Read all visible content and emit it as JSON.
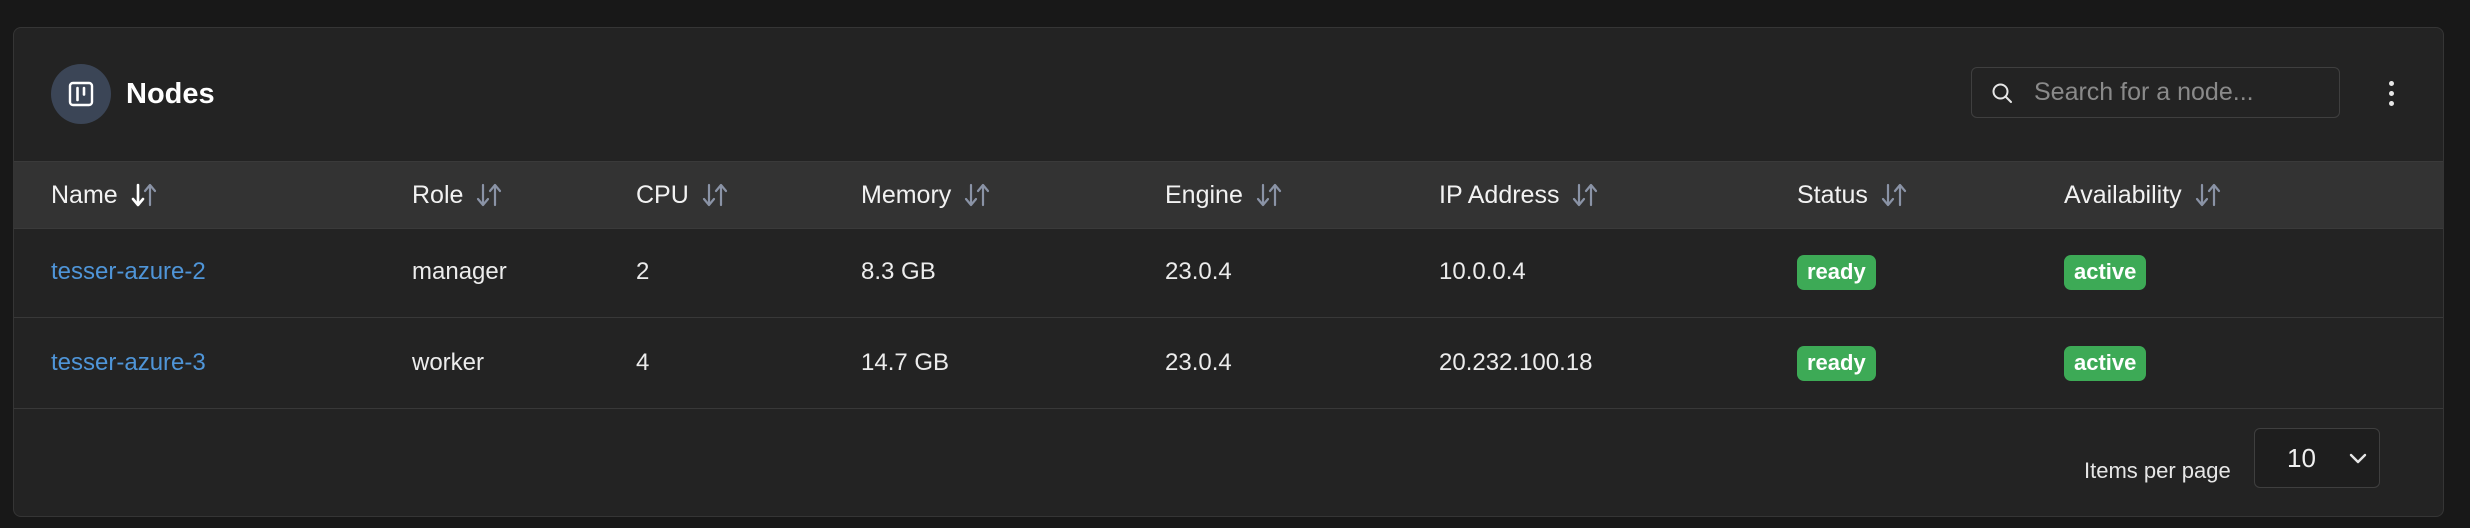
{
  "panel": {
    "title": "Nodes",
    "title_icon": "board-icon",
    "search": {
      "placeholder": "Search for a node...",
      "value": ""
    },
    "menu_icon": "kebab-menu-icon"
  },
  "table": {
    "columns": [
      {
        "key": "name",
        "label": "Name",
        "sorted": "desc"
      },
      {
        "key": "role",
        "label": "Role",
        "sorted": null
      },
      {
        "key": "cpu",
        "label": "CPU",
        "sorted": null
      },
      {
        "key": "memory",
        "label": "Memory",
        "sorted": null
      },
      {
        "key": "engine",
        "label": "Engine",
        "sorted": null
      },
      {
        "key": "ip",
        "label": "IP Address",
        "sorted": null
      },
      {
        "key": "status",
        "label": "Status",
        "sorted": null
      },
      {
        "key": "availability",
        "label": "Availability",
        "sorted": null
      }
    ],
    "rows": [
      {
        "name": "tesser-azure-2",
        "role": "manager",
        "cpu": "2",
        "memory": "8.3 GB",
        "engine": "23.0.4",
        "ip": "10.0.0.4",
        "status": "ready",
        "availability": "active"
      },
      {
        "name": "tesser-azure-3",
        "role": "worker",
        "cpu": "4",
        "memory": "14.7 GB",
        "engine": "23.0.4",
        "ip": "20.232.100.18",
        "status": "ready",
        "availability": "active"
      }
    ]
  },
  "pagination": {
    "items_per_page_label": "Items per page",
    "items_per_page_value": "10"
  },
  "colors": {
    "background": "#181818",
    "panel": "#232323",
    "header_row": "#333333",
    "link": "#4f95d8",
    "badge_green": "#3daa56",
    "icon_circle": "#3b4556",
    "sort_icon_inactive": "#8a93a6"
  }
}
